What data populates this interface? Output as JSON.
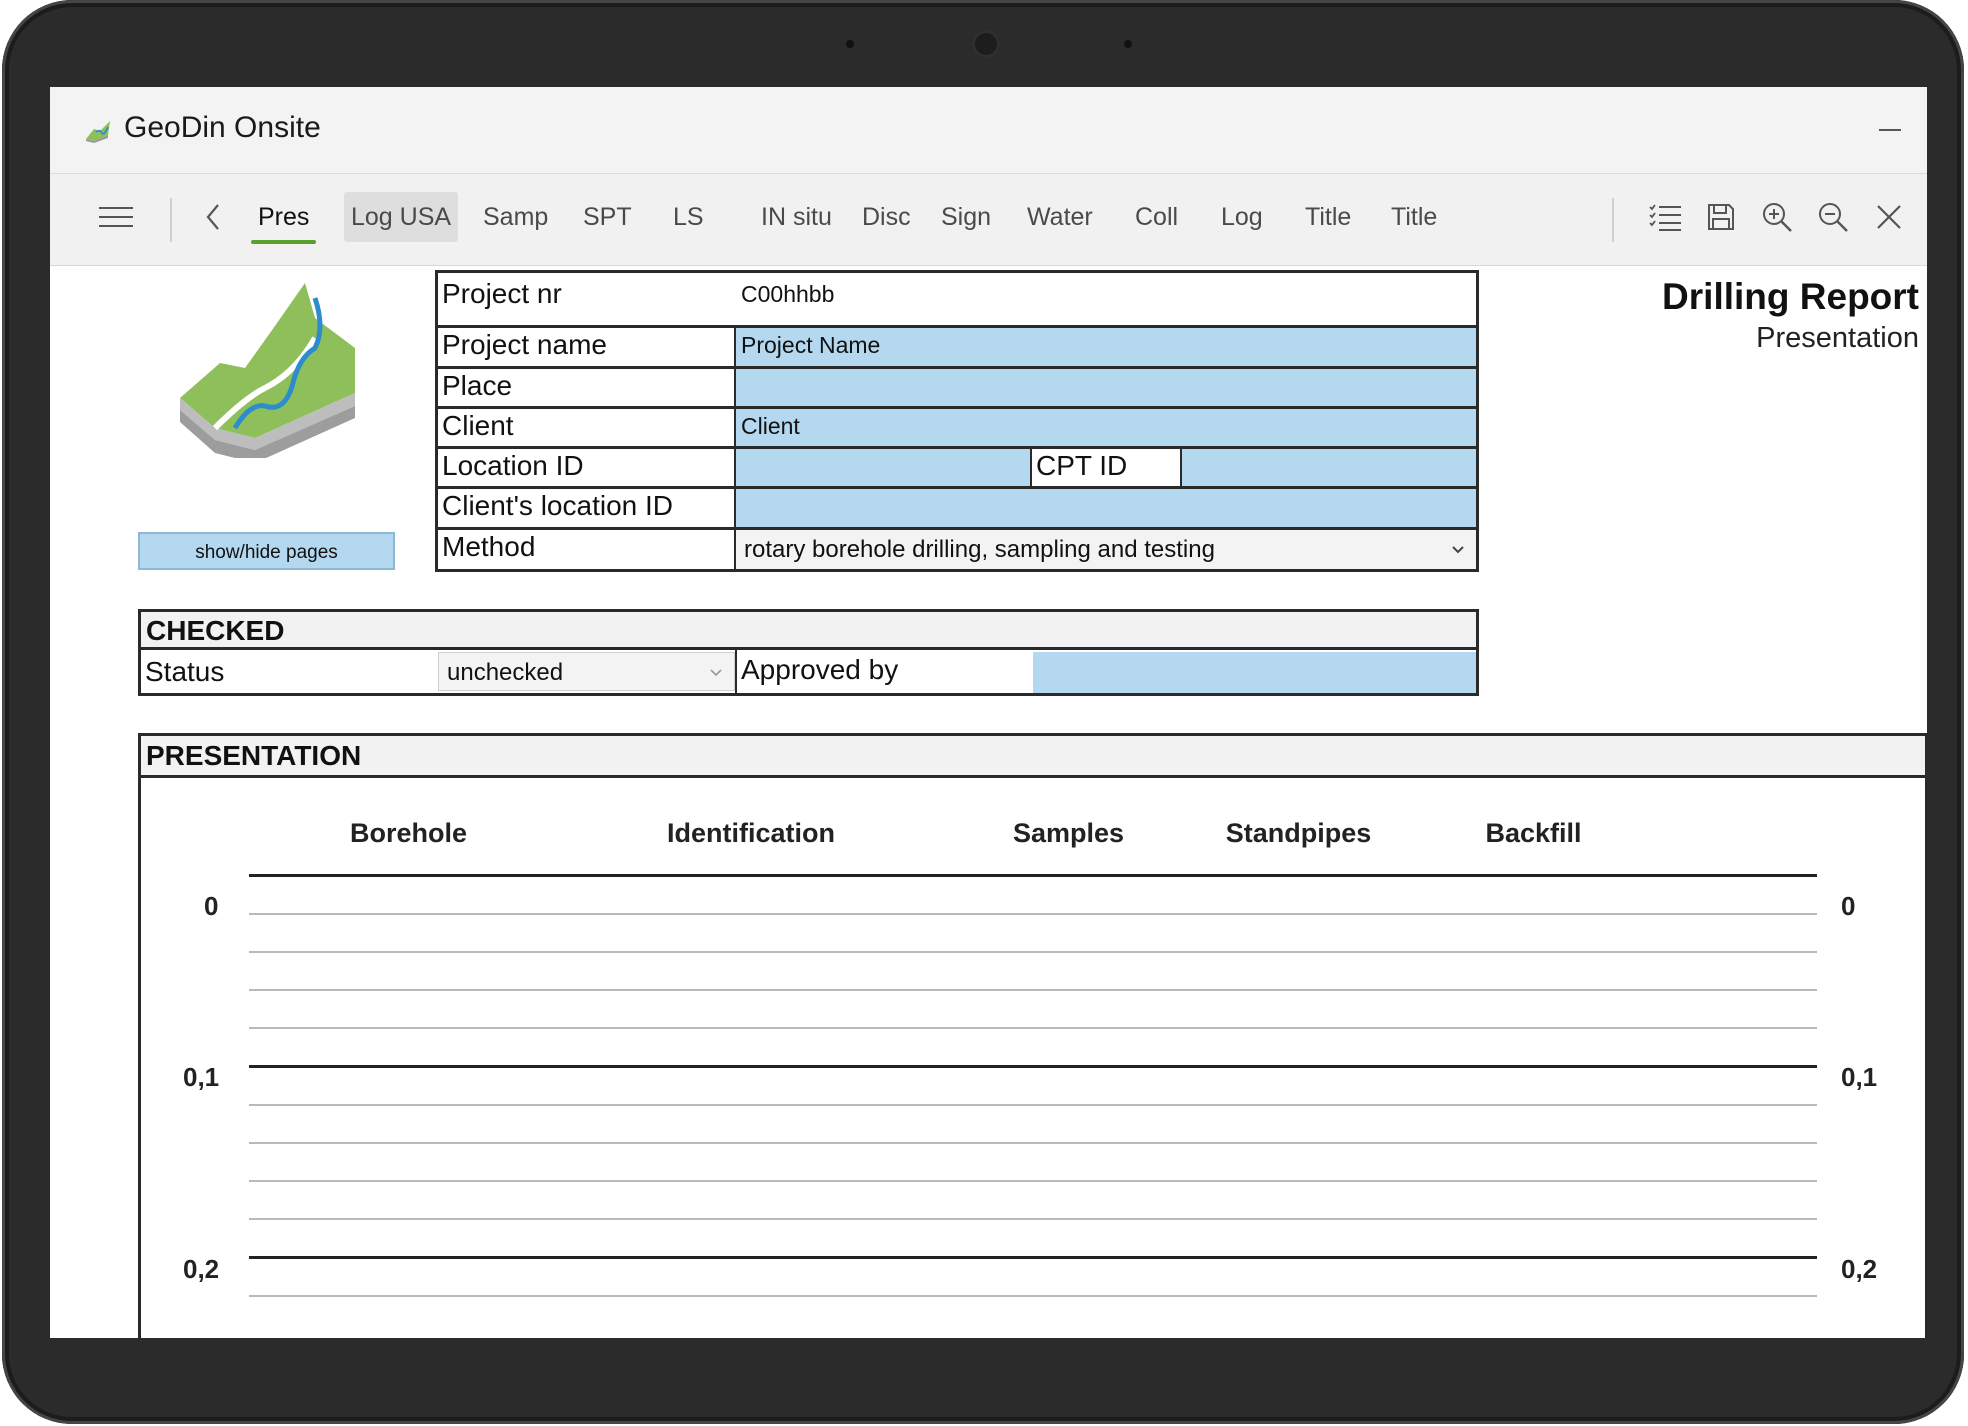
{
  "app": {
    "title": "GeoDin Onsite",
    "accent_color": "#5aa02c",
    "field_color": "#b3d8ef"
  },
  "toolbar": {
    "tabs": [
      {
        "label": "Pres",
        "active": true
      },
      {
        "label": "Log USA",
        "hover": true
      },
      {
        "label": "Samp"
      },
      {
        "label": "SPT"
      },
      {
        "label": "LS"
      },
      {
        "label": "IN situ"
      },
      {
        "label": "Disc"
      },
      {
        "label": "Sign"
      },
      {
        "label": "Water"
      },
      {
        "label": "Coll"
      },
      {
        "label": "Log"
      },
      {
        "label": "Title"
      },
      {
        "label": "Title"
      }
    ],
    "icons": [
      "menu-icon",
      "back-chevron-icon",
      "checklist-icon",
      "save-icon",
      "zoom-in-icon",
      "zoom-out-icon",
      "close-icon"
    ]
  },
  "sidebar": {
    "show_hide_label": "show/hide pages"
  },
  "report": {
    "title": "Drilling Report",
    "subtitle": "Presentation"
  },
  "project": {
    "project_nr_label": "Project nr",
    "project_nr_value": "C00hhbb",
    "project_name_label": "Project name",
    "project_name_value": "Project Name",
    "place_label": "Place",
    "place_value": "",
    "client_label": "Client",
    "client_value": "Client",
    "location_id_label": "Location ID",
    "location_id_value": "",
    "cpt_id_label": "CPT ID",
    "cpt_id_value": "",
    "client_location_label": "Client's location ID",
    "client_location_value": "",
    "method_label": "Method",
    "method_value": "rotary borehole drilling, sampling and testing"
  },
  "checked": {
    "heading": "CHECKED",
    "status_label": "Status",
    "status_value": "unchecked",
    "approved_label": "Approved by",
    "approved_value": ""
  },
  "presentation": {
    "heading": "PRESENTATION",
    "columns": [
      "Borehole",
      "Identification",
      "Samples",
      "Standpipes",
      "Backfill"
    ],
    "depth_labels": [
      "0",
      "0,1",
      "0,2"
    ]
  }
}
